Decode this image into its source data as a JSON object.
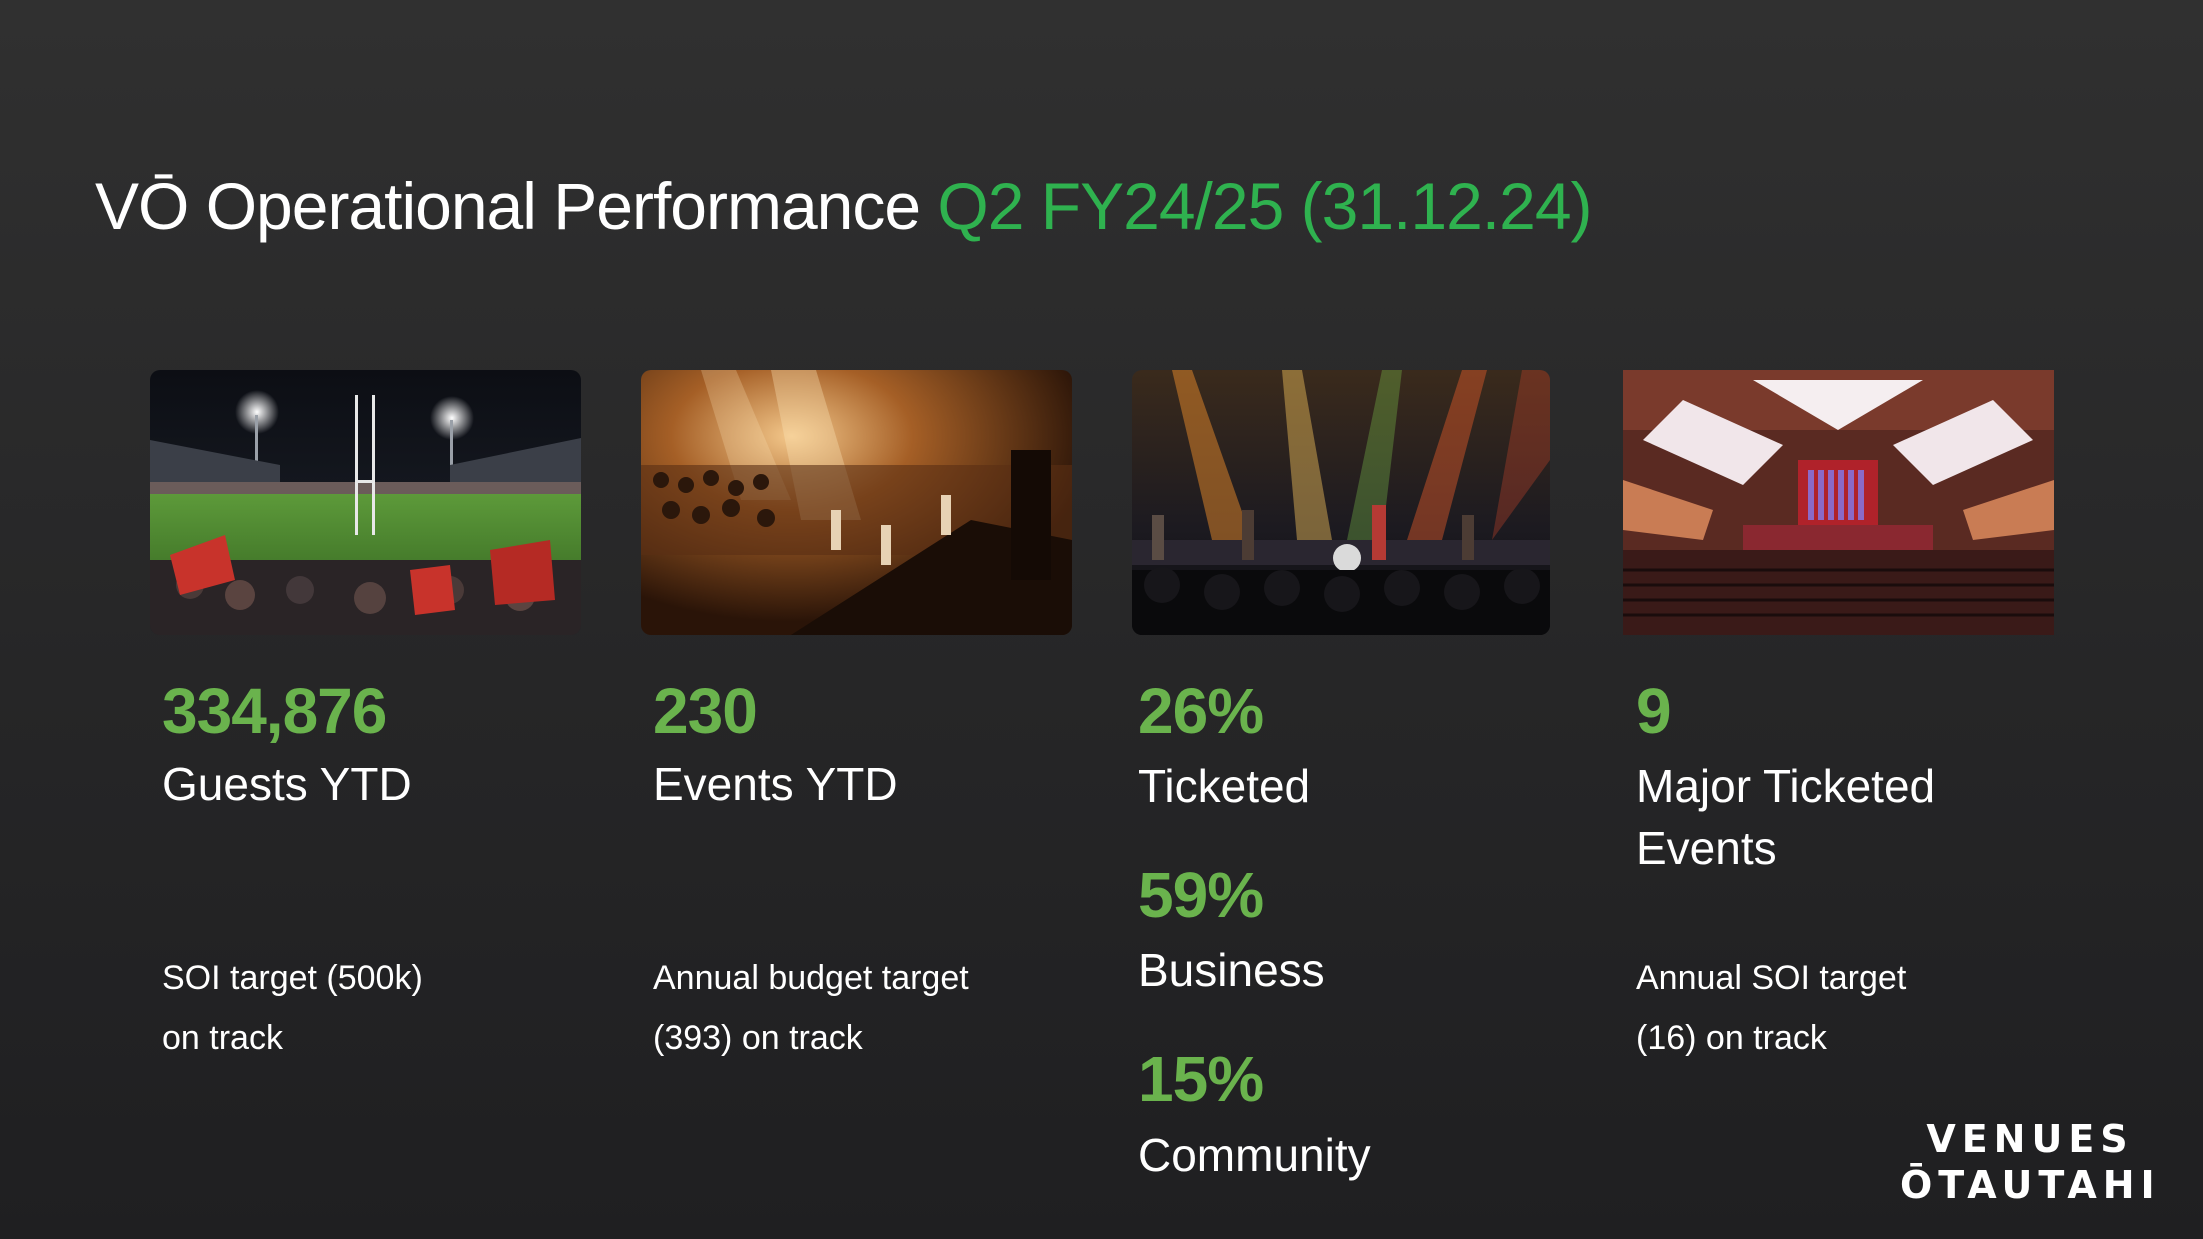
{
  "title": {
    "main": "VŌ Operational Performance",
    "period": "Q2 FY24/25 (31.12.24)"
  },
  "colors": {
    "accent_title": "#2fb24f",
    "accent_stats": "#6ab34d",
    "background": "#2a2a2b"
  },
  "images": [
    "stadium-photo",
    "concert-crowd-photo",
    "band-stage-photo",
    "concert-hall-photo"
  ],
  "stats": {
    "guests": {
      "value": "334,876",
      "label": "Guests YTD",
      "note_line1": "SOI target (500k)",
      "note_line2": "on track"
    },
    "events": {
      "value": "230",
      "label": "Events YTD",
      "note_line1": "Annual budget target",
      "note_line2": "(393) on track"
    },
    "mix": {
      "ticketed_value": "26%",
      "ticketed_label": "Ticketed",
      "business_value": "59%",
      "business_label": "Business",
      "community_value": "15%",
      "community_label": "Community"
    },
    "major": {
      "value": "9",
      "label_line1": "Major Ticketed",
      "label_line2": "Events",
      "note_line1": "Annual SOI target",
      "note_line2": "(16) on track"
    }
  },
  "logo": {
    "line1": "VENUES",
    "line2": "ŌTAUTAHI"
  }
}
